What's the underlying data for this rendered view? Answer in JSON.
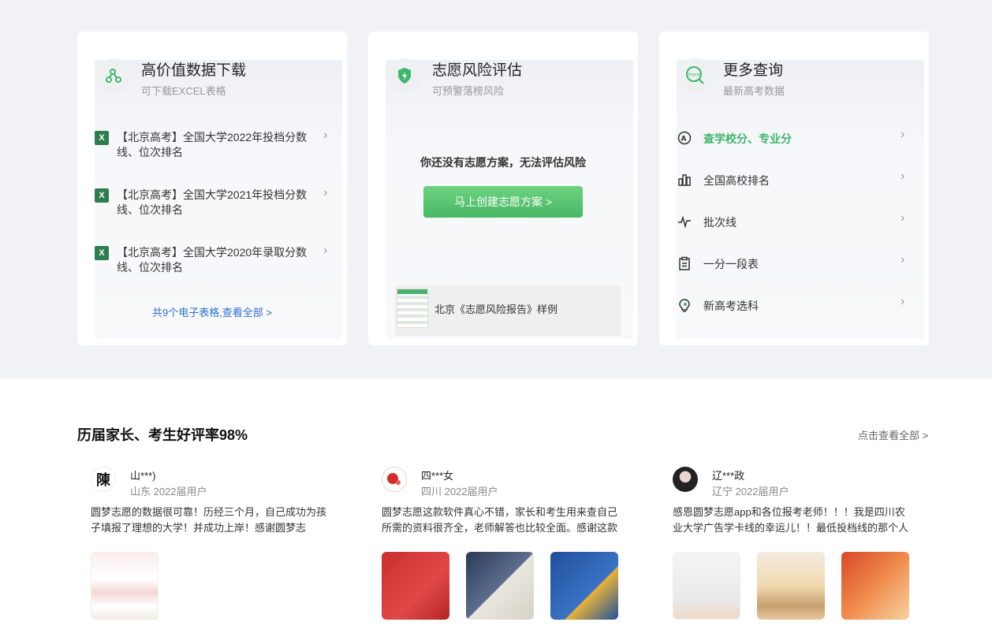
{
  "cards": {
    "download": {
      "title": "高价值数据下载",
      "subtitle": "可下载EXCEL表格",
      "icon": "share-nodes-icon",
      "items": [
        {
          "text": "【北京高考】全国大学2022年投档分数线、位次排名"
        },
        {
          "text": "【北京高考】全国大学2021年投档分数线、位次排名"
        },
        {
          "text": "【北京高考】全国大学2020年录取分数线、位次排名"
        }
      ],
      "more_link": "共9个电子表格,查看全部 >"
    },
    "risk": {
      "title": "志愿风险评估",
      "subtitle": "可预警落榜风险",
      "icon": "shield-bolt-icon",
      "message": "你还没有志愿方案，无法评估风险",
      "button": "马上创建志愿方案 >",
      "report_label": "北京《志愿风险报告》样例"
    },
    "query": {
      "title": "更多查询",
      "subtitle": "最新高考数据",
      "icon": "magnifier-more-icon",
      "items": [
        {
          "label": "查学校分、专业分",
          "icon": "score-a-icon"
        },
        {
          "label": "全国高校排名",
          "icon": "bar-chart-icon"
        },
        {
          "label": "批次线",
          "icon": "pulse-line-icon"
        },
        {
          "label": "一分一段表",
          "icon": "clipboard-icon"
        },
        {
          "label": "新高考选科",
          "icon": "lightbulb-icon"
        }
      ]
    }
  },
  "reviews_section": {
    "title": "历届家长、考生好评率98%",
    "more": "点击查看全部 >",
    "reviews": [
      {
        "name": "山***)",
        "meta": "山东 2022届用户",
        "avatar_char": "陳",
        "text": "圆梦志愿的数据很可靠！历经三个月，自己成功为孩子填报了理想的大学！并成功上岸！感谢圆梦志愿！！！"
      },
      {
        "name": "四***女",
        "meta": "四川 2022届用户",
        "avatar_char": "",
        "text": "圆梦志愿这款软件真心不错，家长和考生用来查自己所需的资料很齐全，老师解答也比较全面。感谢这款软件"
      },
      {
        "name": "辽***政",
        "meta": "辽宁 2022届用户",
        "avatar_char": "",
        "text": "感恩圆梦志愿app和各位报考老师！！！我是四川农业大学广告学卡线的幸运儿！！最低投档线的那个人就是我"
      }
    ]
  },
  "colors": {
    "accent_green": "#3db76b",
    "link_blue": "#2f6fd6",
    "background_grey": "#f1f2f6"
  }
}
